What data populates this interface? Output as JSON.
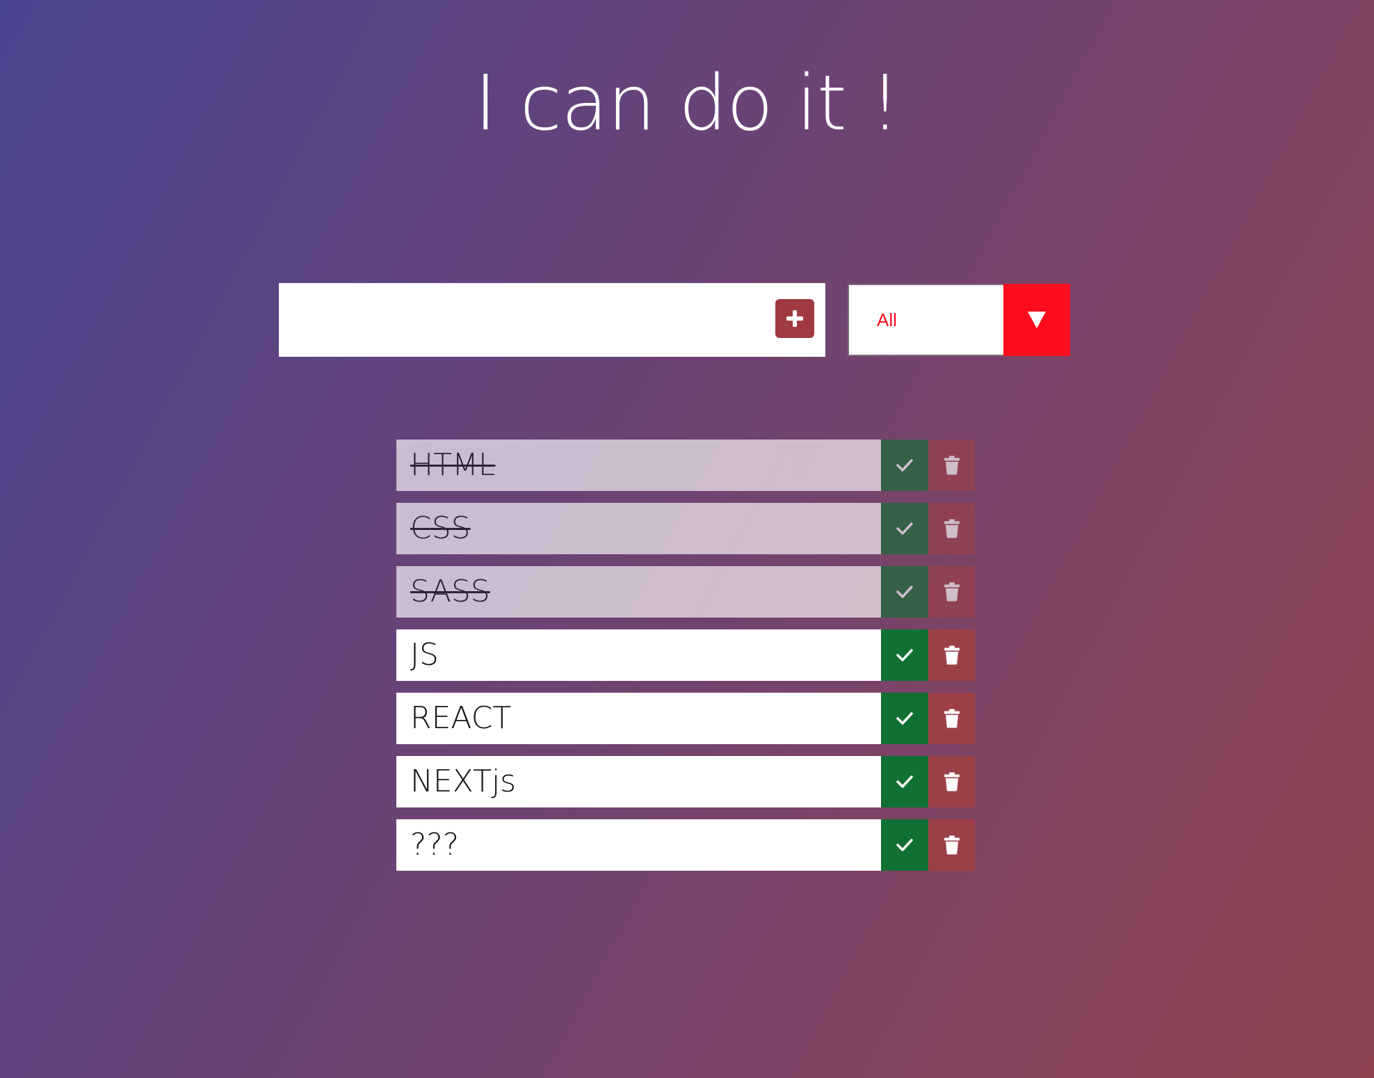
{
  "header": {
    "title": "I can do it !"
  },
  "form": {
    "input_value": "",
    "add_icon": "plus-icon",
    "filter": {
      "selected": "All",
      "arrow_icon": "triangle-down-icon"
    }
  },
  "todos": [
    {
      "text": "HTML",
      "completed": true
    },
    {
      "text": "CSS",
      "completed": true
    },
    {
      "text": "SASS",
      "completed": true
    },
    {
      "text": "JS",
      "completed": false
    },
    {
      "text": "REACT",
      "completed": false
    },
    {
      "text": "NEXTjs",
      "completed": false
    },
    {
      "text": "???",
      "completed": false
    }
  ],
  "icons": {
    "complete": "check-icon",
    "delete": "trash-icon"
  },
  "colors": {
    "complete_button": "#117033",
    "delete_button": "#9c4048",
    "add_button": "#a03a42",
    "filter_accent": "#fe0d1e"
  }
}
